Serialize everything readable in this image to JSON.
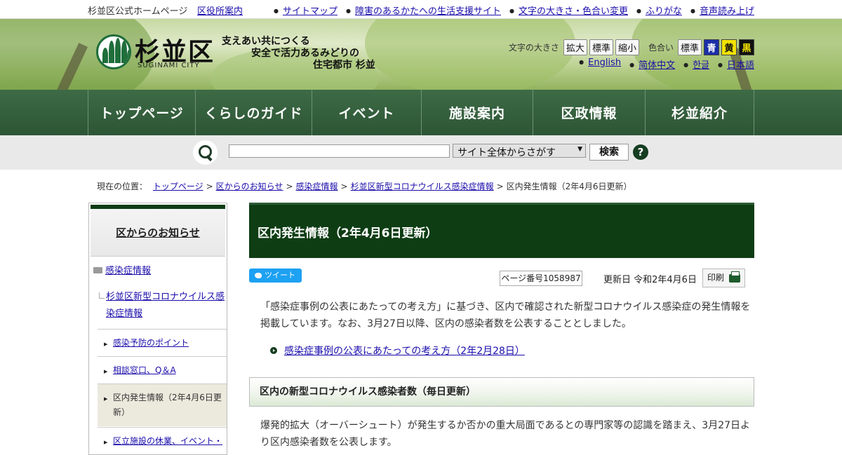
{
  "util": {
    "site_name": "杉並区公式ホームページ",
    "office_guide": "区役所案内",
    "links": [
      "サイトマップ",
      "障害のあるかたへの生活支援サイト",
      "文字の大きさ・色合い変更",
      "ふりがな",
      "音声読み上げ"
    ]
  },
  "header": {
    "logo_text": "杉並区",
    "logo_sub": "SUGINAMI CITY",
    "slogan": [
      "支えあい共につくる",
      "安全で活力あるみどりの",
      "住宅都市 杉並"
    ],
    "font_size_label": "文字の大きさ",
    "font_size_buttons": [
      "拡大",
      "標準",
      "縮小"
    ],
    "color_label": "色合い",
    "color_standard": "標準",
    "color_buttons": [
      {
        "label": "青",
        "bg": "#1a2fa8",
        "fg": "#ffffff"
      },
      {
        "label": "黄",
        "bg": "#f2e300",
        "fg": "#111111"
      },
      {
        "label": "黒",
        "bg": "#111111",
        "fg": "#f2e300"
      }
    ],
    "languages": [
      "English",
      "简体中文",
      "한글",
      "日本語"
    ]
  },
  "nav": [
    "トップページ",
    "くらしのガイド",
    "イベント",
    "施設案内",
    "区政情報",
    "杉並紹介"
  ],
  "search": {
    "value": "",
    "scope": "サイト全体からさがす",
    "button": "検索",
    "help": "?"
  },
  "breadcrumb": {
    "label": "現在の位置：",
    "items": [
      "トップページ",
      "区からのお知らせ",
      "感染症情報",
      "杉並区新型コロナウイルス感染症情報"
    ],
    "current": "区内発生情報（2年4月6日更新）"
  },
  "sidebar": {
    "title": "区からのお知らせ",
    "level1": "感染症情報",
    "level2": "杉並区新型コロナウイルス感染症情報",
    "items": [
      "感染予防のポイント",
      "相談窓口、Q＆A",
      "区内発生情報（2年4月6日更新）",
      "区立施設の休業、イベント・"
    ]
  },
  "main": {
    "title": "区内発生情報（2年4月6日更新）",
    "tweet": "ツイート",
    "page_number": "ページ番号1058987",
    "updated": "更新日 令和2年4月6日",
    "print": "印刷",
    "lead": "「感染症事例の公表にあたっての考え方」に基づき、区内で確認された新型コロナウイルス感染症の発生情報を掲載しています。なお、3月27日以降、区内の感染者数を公表することとしました。",
    "link": "感染症事例の公表にあたっての考え方（2年2月28日）",
    "heading2": "区内の新型コロナウイルス感染者数（毎日更新）",
    "body2": "爆発的拡大（オーバーシュート）が発生するか否かの重大局面であるとの専門家等の認識を踏まえ、3月27日より区内感染者数を公表します。"
  }
}
